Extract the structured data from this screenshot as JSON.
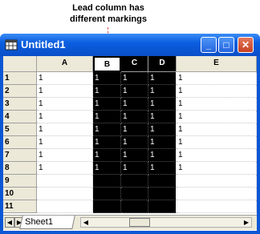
{
  "callout": {
    "line1": "Lead column has",
    "line2": "different markings"
  },
  "window": {
    "title": "Untitled1",
    "minimize_label": "_",
    "maximize_label": "□",
    "close_label": "✕"
  },
  "columns": [
    "",
    "A",
    "B",
    "C",
    "D",
    "E"
  ],
  "rows": [
    {
      "label": "1",
      "cells": [
        "1",
        "1",
        "1",
        "1",
        "1"
      ]
    },
    {
      "label": "2",
      "cells": [
        "1",
        "1",
        "1",
        "1",
        "1"
      ]
    },
    {
      "label": "3",
      "cells": [
        "1",
        "1",
        "1",
        "1",
        "1"
      ]
    },
    {
      "label": "4",
      "cells": [
        "1",
        "1",
        "1",
        "1",
        "1"
      ]
    },
    {
      "label": "5",
      "cells": [
        "1",
        "1",
        "1",
        "1",
        "1"
      ]
    },
    {
      "label": "6",
      "cells": [
        "1",
        "1",
        "1",
        "1",
        "1"
      ]
    },
    {
      "label": "7",
      "cells": [
        "1",
        "1",
        "1",
        "1",
        "1"
      ]
    },
    {
      "label": "8",
      "cells": [
        "1",
        "1",
        "1",
        "1",
        "1"
      ]
    },
    {
      "label": "9",
      "cells": [
        "",
        "",
        "",
        "",
        ""
      ]
    },
    {
      "label": "10",
      "cells": [
        "",
        "",
        "",
        "",
        ""
      ]
    },
    {
      "label": "11",
      "cells": [
        "",
        "",
        "",
        "",
        ""
      ]
    }
  ],
  "selection": {
    "selected_columns": [
      "B",
      "C",
      "D"
    ],
    "lead_column": "B"
  },
  "sheet_tab": "Sheet1",
  "icons": {
    "first_sheet": "◀",
    "next_sheet": "▶",
    "scroll_left": "◀",
    "scroll_right": "▶"
  },
  "colors": {
    "selection": "#000000",
    "header_bg": "#ece9d8",
    "titlebar": "#0a5ee0",
    "callout_line": "#e06060"
  }
}
